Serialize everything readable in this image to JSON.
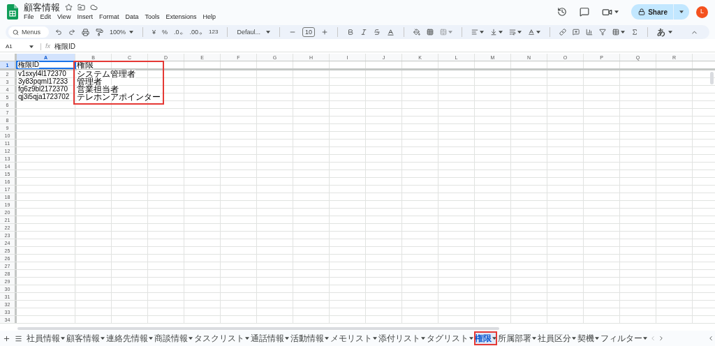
{
  "app": {
    "title": "顧客情報",
    "menus": [
      "File",
      "Edit",
      "View",
      "Insert",
      "Format",
      "Data",
      "Tools",
      "Extensions",
      "Help"
    ],
    "share_label": "Share",
    "avatar_initial": "L"
  },
  "toolbar": {
    "search_placeholder": "Menus",
    "zoom": "100%",
    "currency": "¥",
    "percent": "%",
    "decrease_decimals": ".0",
    "increase_decimals": ".00",
    "number_format": "123",
    "font": "Defaul...",
    "font_size": "10",
    "input_tool": "あ"
  },
  "formula_bar": {
    "cell_ref": "A1",
    "fx": "fx",
    "value": "権限ID"
  },
  "sheet": {
    "columns": [
      {
        "label": "A",
        "selected": true
      },
      {
        "label": "B",
        "selected": false
      },
      {
        "label": "C",
        "selected": false
      },
      {
        "label": "D",
        "selected": false
      },
      {
        "label": "E",
        "selected": false
      },
      {
        "label": "F",
        "selected": false
      },
      {
        "label": "G",
        "selected": false
      },
      {
        "label": "H",
        "selected": false
      },
      {
        "label": "I",
        "selected": false
      },
      {
        "label": "J",
        "selected": false
      },
      {
        "label": "K",
        "selected": false
      },
      {
        "label": "L",
        "selected": false
      },
      {
        "label": "M",
        "selected": false
      },
      {
        "label": "N",
        "selected": false
      },
      {
        "label": "O",
        "selected": false
      },
      {
        "label": "P",
        "selected": false
      },
      {
        "label": "Q",
        "selected": false
      },
      {
        "label": "R",
        "selected": false
      }
    ],
    "rows": [
      {
        "number": "1",
        "selected": true,
        "cells": [
          "権限ID",
          "権限"
        ]
      },
      {
        "number": "2",
        "selected": false,
        "cells": [
          "v1sxyl4l172370",
          "システム管理者"
        ]
      },
      {
        "number": "3",
        "selected": false,
        "cells": [
          "3y83pqml17233",
          "管理者"
        ]
      },
      {
        "number": "4",
        "selected": false,
        "cells": [
          "fg6z9bl2172370",
          "営業担当者"
        ]
      },
      {
        "number": "5",
        "selected": false,
        "cells": [
          "qj3i5qja1723702",
          "テレホンアポインター"
        ]
      },
      {
        "number": "6",
        "selected": false
      },
      {
        "number": "7",
        "selected": false
      },
      {
        "number": "8",
        "selected": false
      },
      {
        "number": "9",
        "selected": false
      },
      {
        "number": "10",
        "selected": false
      },
      {
        "number": "11",
        "selected": false
      },
      {
        "number": "12",
        "selected": false
      },
      {
        "number": "13",
        "selected": false
      },
      {
        "number": "14",
        "selected": false
      },
      {
        "number": "15",
        "selected": false
      },
      {
        "number": "16",
        "selected": false
      },
      {
        "number": "17",
        "selected": false
      },
      {
        "number": "18",
        "selected": false
      },
      {
        "number": "19",
        "selected": false
      },
      {
        "number": "20",
        "selected": false
      },
      {
        "number": "21",
        "selected": false
      },
      {
        "number": "22",
        "selected": false
      },
      {
        "number": "23",
        "selected": false
      },
      {
        "number": "24",
        "selected": false
      },
      {
        "number": "25",
        "selected": false
      },
      {
        "number": "26",
        "selected": false
      },
      {
        "number": "27",
        "selected": false
      },
      {
        "number": "28",
        "selected": false
      },
      {
        "number": "29",
        "selected": false
      },
      {
        "number": "30",
        "selected": false
      },
      {
        "number": "31",
        "selected": false
      },
      {
        "number": "32",
        "selected": false
      },
      {
        "number": "33",
        "selected": false
      },
      {
        "number": "34",
        "selected": false
      }
    ]
  },
  "tabs": [
    {
      "label": "社員情報",
      "selected": false
    },
    {
      "label": "顧客情報",
      "selected": false
    },
    {
      "label": "連絡先情報",
      "selected": false
    },
    {
      "label": "商談情報",
      "selected": false
    },
    {
      "label": "タスクリスト",
      "selected": false
    },
    {
      "label": "通話情報",
      "selected": false
    },
    {
      "label": "活動情報",
      "selected": false
    },
    {
      "label": "メモリスト",
      "selected": false
    },
    {
      "label": "添付リスト",
      "selected": false
    },
    {
      "label": "タグリスト",
      "selected": false
    },
    {
      "label": "権限",
      "selected": true
    },
    {
      "label": "所属部署",
      "selected": false
    },
    {
      "label": "社員区分",
      "selected": false
    },
    {
      "label": "契機",
      "selected": false
    },
    {
      "label": "フィルター",
      "selected": false
    }
  ]
}
